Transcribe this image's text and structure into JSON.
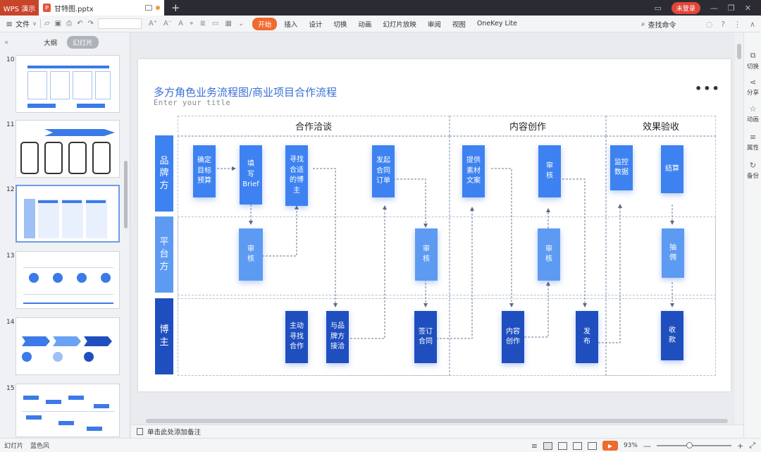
{
  "titlebar": {
    "app_name": "WPS 演示",
    "doc_name": "甘特图.pptx",
    "login": "未登录"
  },
  "menubar": {
    "file": "文件",
    "tabs": [
      "开始",
      "插入",
      "设计",
      "切换",
      "动画",
      "幻灯片放映",
      "审阅",
      "视图",
      "OneKey Lite"
    ],
    "active_tab": "开始",
    "search": "查找命令"
  },
  "leftpanel": {
    "outline": "大纲",
    "slides": "幻灯片",
    "thumbnails": [
      "10",
      "11",
      "12",
      "13",
      "14",
      "15"
    ],
    "selected": "12"
  },
  "rightbar": [
    "切换",
    "分享",
    "动画",
    "属性",
    "备份"
  ],
  "notes": "单击此处添加备注",
  "statusbar": {
    "slide": "幻灯片",
    "theme": "蓝色风",
    "zoom": "93%",
    "zoom_fraction": 0.43
  },
  "slide": {
    "title": "多方角色业务流程图/商业项目合作流程",
    "subtitle": "Enter your title",
    "phases": [
      "合作洽谈",
      "内容创作",
      "效果验收"
    ],
    "roles": [
      "品\n牌\n方",
      "平\n台\n方",
      "博\n主"
    ],
    "nodes": {
      "brand_budget": "确定\n目标\n预算",
      "brand_brief": "填\n写\nBrief",
      "brand_find": "寻找\n合适\n的博\n主",
      "brand_order": "发起\n合同\n订单",
      "brand_material": "提供\n素材\n文案",
      "brand_review": "审\n核",
      "brand_monitor": "监控\n数据",
      "brand_settle": "结算",
      "plat_review1": "审\n核",
      "plat_review2": "审\n核",
      "plat_review3": "审\n核",
      "plat_commission": "抽\n佣",
      "blog_active": "主动\n寻找\n合作",
      "blog_negotiate": "与品\n牌方\n接洽",
      "blog_sign": "签订\n合同",
      "blog_create": "内容\n创作",
      "blog_publish": "发\n布",
      "blog_pay": "收\n款"
    }
  },
  "colors": {
    "accent": "#3b6fd6",
    "node_brand": "#3d82f0",
    "node_platform": "#5d9bf3",
    "node_blogger": "#1f4fbf",
    "start_tab": "#f06a2e"
  }
}
